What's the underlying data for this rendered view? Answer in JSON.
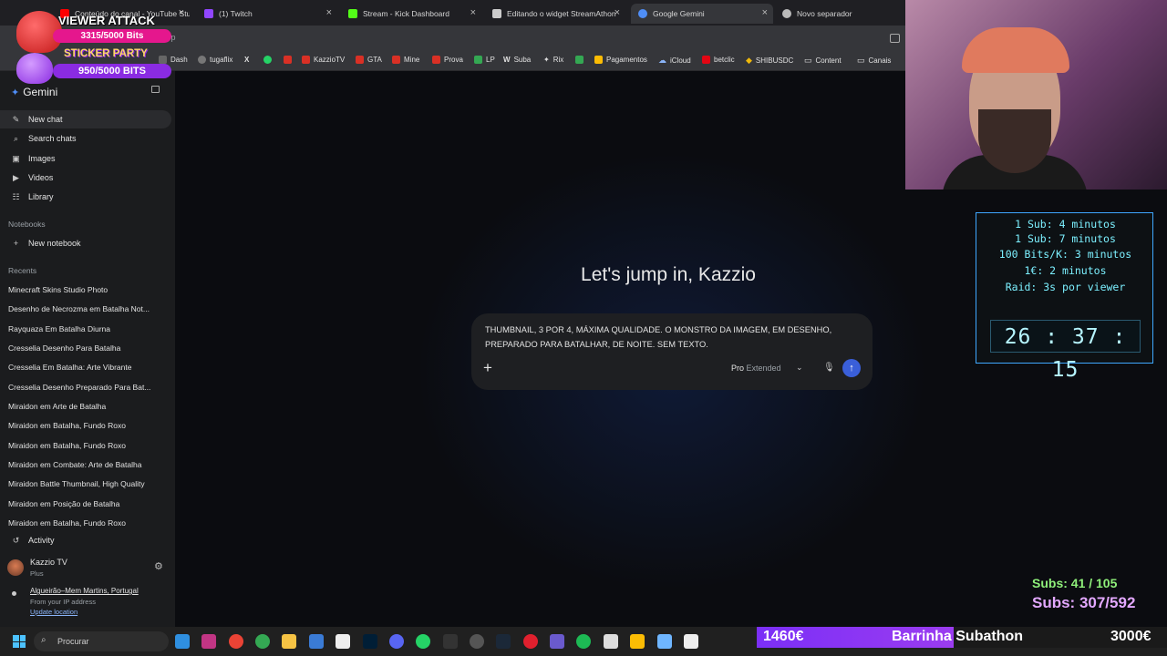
{
  "browser": {
    "tabs": [
      {
        "label": "Conteúdo do canal - YouTube Studio",
        "color": "#ff0000"
      },
      {
        "label": "(1) Twitch",
        "color": "#9146ff"
      },
      {
        "label": "Stream - Kick Dashboard",
        "color": "#53fc18"
      },
      {
        "label": "Editando o widget StreamAthon",
        "color": "#cccccc"
      },
      {
        "label": "Google Gemini",
        "color": "#4f8ef7"
      },
      {
        "label": "Novo separador",
        "color": "#bbbbbb"
      }
    ],
    "url": "/app",
    "bookmarks": [
      "Dash",
      "tugaflix",
      "X",
      "",
      "",
      "KazzioTV",
      "GTA",
      "Mine",
      "Prova",
      "LP",
      "Suba",
      "Rix",
      "Pagamentos",
      "iCloud",
      "betclic",
      "SHIBUSDC",
      "Content",
      "Canais"
    ]
  },
  "sidebar": {
    "app_name": "Gemini",
    "nav": [
      {
        "label": "New chat",
        "icon": "✎"
      },
      {
        "label": "Search chats",
        "icon": "⌕"
      },
      {
        "label": "Images",
        "icon": "▣"
      },
      {
        "label": "Videos",
        "icon": "▶"
      },
      {
        "label": "Library",
        "icon": "☷"
      }
    ],
    "notebooks_label": "Notebooks",
    "new_notebook": "New notebook",
    "recents_label": "Recents",
    "recents": [
      "Minecraft Skins Studio Photo",
      "Desenho de Necrozma em Batalha Not...",
      "Rayquaza Em Batalha Diurna",
      "Cresselia Desenho Para Batalha",
      "Cresselia Em Batalha: Arte Vibrante",
      "Cresselia Desenho Preparado Para Bat...",
      "Miraidon em Arte de Batalha",
      "Miraidon em Batalha, Fundo Roxo",
      "Miraidon em Batalha, Fundo Roxo",
      "Miraidon em Combate: Arte de Batalha",
      "Miraidon Battle Thumbnail, High Quality",
      "Miraidon em Posição de Batalha",
      "Miraidon em Batalha, Fundo Roxo"
    ],
    "activity": "Activity",
    "account_name": "Kazzio TV",
    "account_plan": "Plus",
    "location": "Algueirão–Mem Martins, Portugal",
    "location_source": "From your IP address",
    "update_location": "Update location"
  },
  "main": {
    "greeting": "Let's jump in, Kazzio",
    "prompt": "THUMBNAIL, 3 POR 4, MÁXIMA QUALIDADE. O MONSTRO DA IMAGEM, EM DESENHO, PREPARADO PARA BATALHAR, DE NOITE. SEM TEXTO.",
    "model_name": "Pro",
    "model_mode": "Extended"
  },
  "overlay": {
    "viewer_attack_title": "VIEWER ATTACK",
    "viewer_attack_bits": "3315/5000 Bits",
    "sticker_party_title": "STICKER PARTY",
    "sticker_party_bits": "950/5000 BITS",
    "timer_rules": [
      "1 Sub: 4 minutos",
      "1 Sub: 7 minutos",
      "100 Bits/K: 3 minutos",
      "1€: 2 minutos",
      "Raid: 3s por viewer"
    ],
    "timer_clock": "26 : 37 : 15",
    "subs_line1": "Subs: 41 / 105",
    "subs_line2": "Subs: 307/592",
    "bar_left": "1460€",
    "bar_mid": "Barrinha Subathon",
    "bar_right": "3000€"
  },
  "taskbar": {
    "search_placeholder": "Procurar"
  }
}
